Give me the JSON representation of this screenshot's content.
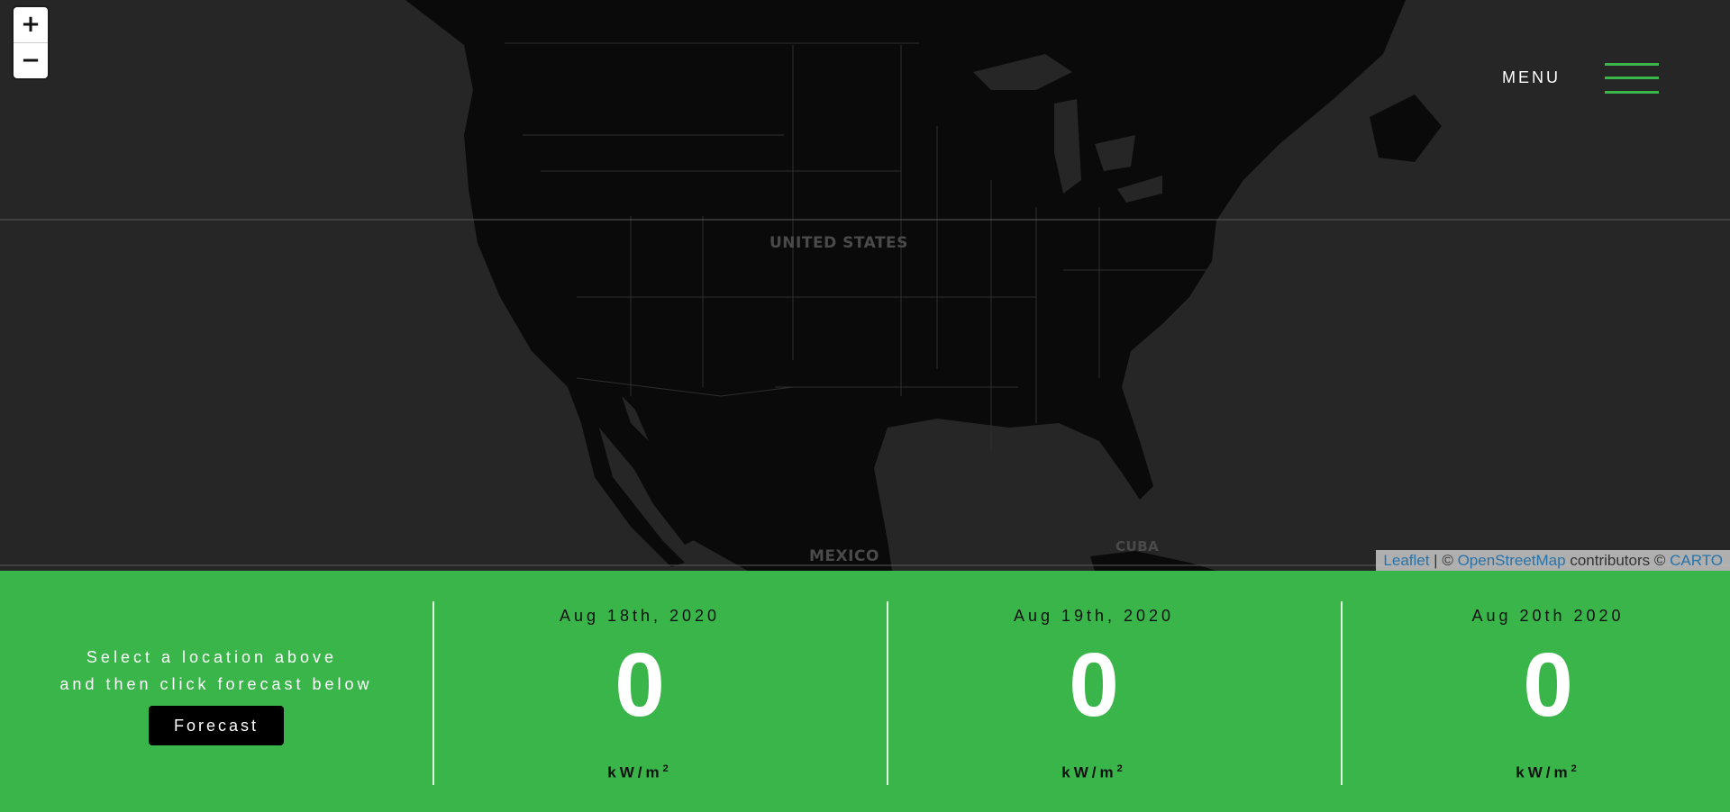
{
  "map": {
    "labels": {
      "united_states": "UNITED STATES",
      "mexico": "MEXICO",
      "cuba": "CUBA"
    },
    "zoom": {
      "in_label": "+",
      "out_label": "−"
    },
    "attribution": {
      "leaflet": "Leaflet",
      "sep1": " | © ",
      "osm": "OpenStreetMap",
      "contributors": " contributors © ",
      "carto": "CARTO"
    }
  },
  "header": {
    "menu_label": "MENU",
    "accent_color": "#3ab54a"
  },
  "panel": {
    "background": "#3ab54a",
    "intro_line1": "Select a location above",
    "intro_line2": "and then click forecast below",
    "forecast_button": "Forecast",
    "days": [
      {
        "date": "Aug 18th, 2020",
        "value": "0",
        "unit": "kW/m",
        "unit_sup": "2"
      },
      {
        "date": "Aug 19th, 2020",
        "value": "0",
        "unit": "kW/m",
        "unit_sup": "2"
      },
      {
        "date": "Aug 20th 2020",
        "value": "0",
        "unit": "kW/m",
        "unit_sup": "2"
      }
    ]
  }
}
